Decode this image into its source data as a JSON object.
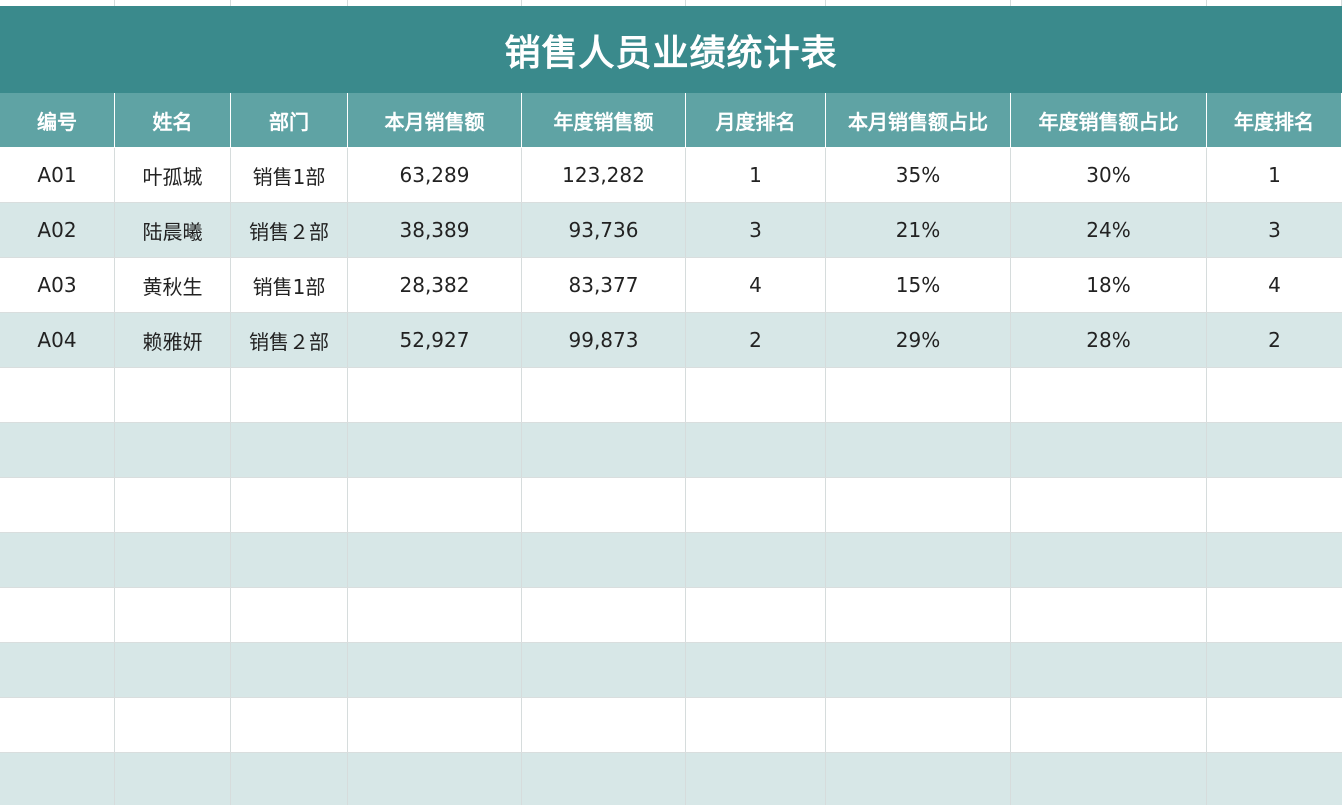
{
  "title": "销售人员业绩统计表",
  "columns": [
    "编号",
    "姓名",
    "部门",
    "本月销售额",
    "年度销售额",
    "月度排名",
    "本月销售额占比",
    "年度销售额占比",
    "年度排名"
  ],
  "rows": [
    [
      "A01",
      "叶孤城",
      "销售1部",
      "63,289",
      "123,282",
      "1",
      "35%",
      "30%",
      "1"
    ],
    [
      "A02",
      "陆晨曦",
      "销售２部",
      "38,389",
      "93,736",
      "3",
      "21%",
      "24%",
      "3"
    ],
    [
      "A03",
      "黄秋生",
      "销售1部",
      "28,382",
      "83,377",
      "4",
      "15%",
      "18%",
      "4"
    ],
    [
      "A04",
      "赖雅妍",
      "销售２部",
      "52,927",
      "99,873",
      "2",
      "29%",
      "28%",
      "2"
    ]
  ],
  "empty_row_count": 8,
  "colors": {
    "title_bg": "#3a8a8c",
    "header_bg": "#5fa3a4",
    "band_bg": "#d7e7e7"
  }
}
